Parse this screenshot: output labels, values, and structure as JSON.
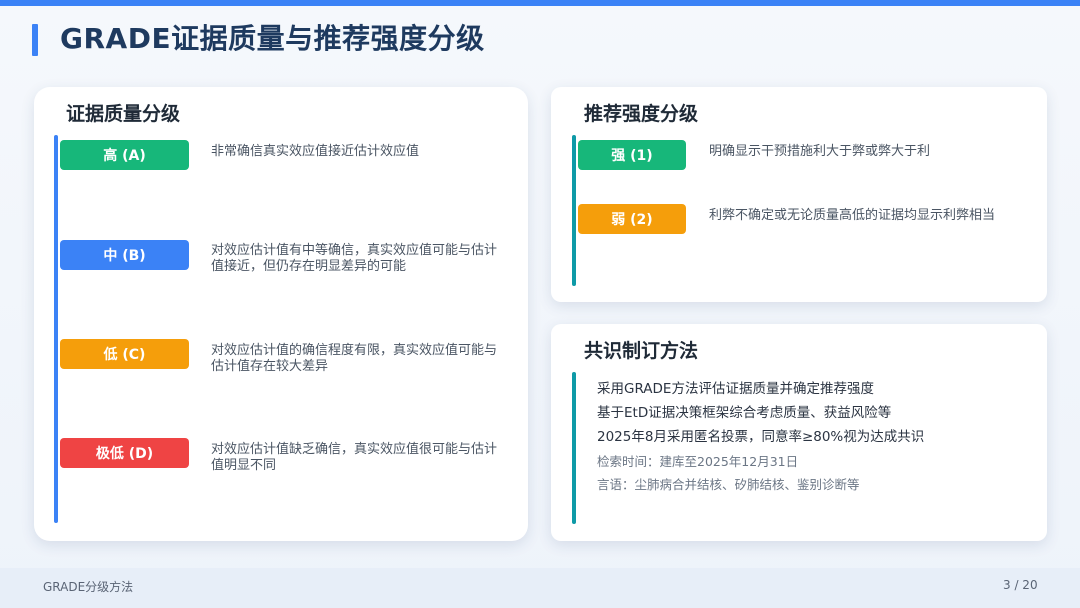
{
  "page_title": "GRADE证据质量与推荐强度分级",
  "quality": {
    "title": "证据质量分级",
    "levels": [
      {
        "label": "高 (A)",
        "desc": "非常确信真实效应值接近估计效应值",
        "color": "#17b77a"
      },
      {
        "label": "中 (B)",
        "desc": "对效应估计值有中等确信，真实效应值可能与估计值接近，但仍存在明显差异的可能",
        "color": "#3b82f6"
      },
      {
        "label": "低 (C)",
        "desc": "对效应估计值的确信程度有限，真实效应值可能与估计值存在较大差异",
        "color": "#f59e0b"
      },
      {
        "label": "极低 (D)",
        "desc": "对效应估计值缺乏确信，真实效应值很可能与估计值明显不同",
        "color": "#ef4444"
      }
    ]
  },
  "strength": {
    "title": "推荐强度分级",
    "levels": [
      {
        "label": "强 (1)",
        "desc": "明确显示干预措施利大于弊或弊大于利",
        "color": "#17b77a"
      },
      {
        "label": "弱 (2)",
        "desc": "利弊不确定或无论质量高低的证据均显示利弊相当",
        "color": "#f59e0b"
      }
    ]
  },
  "consensus": {
    "title": "共识制订方法",
    "lines": [
      "采用GRADE方法评估证据质量并确定推荐强度",
      "基于EtD证据决策框架综合考虑质量、获益风险等",
      "2025年8月采用匿名投票，同意率≥80%视为达成共识"
    ],
    "notes": [
      "检索时间：建库至2025年12月31日",
      "言语：尘肺病合并结核、矽肺结核、鉴别诊断等"
    ]
  },
  "footer": {
    "label": "GRADE分级方法",
    "page": "3 / 20"
  },
  "colors": {
    "accent": "#3b82f6",
    "teal": "#0e9aa7",
    "title_text": "#1e3a5f"
  }
}
